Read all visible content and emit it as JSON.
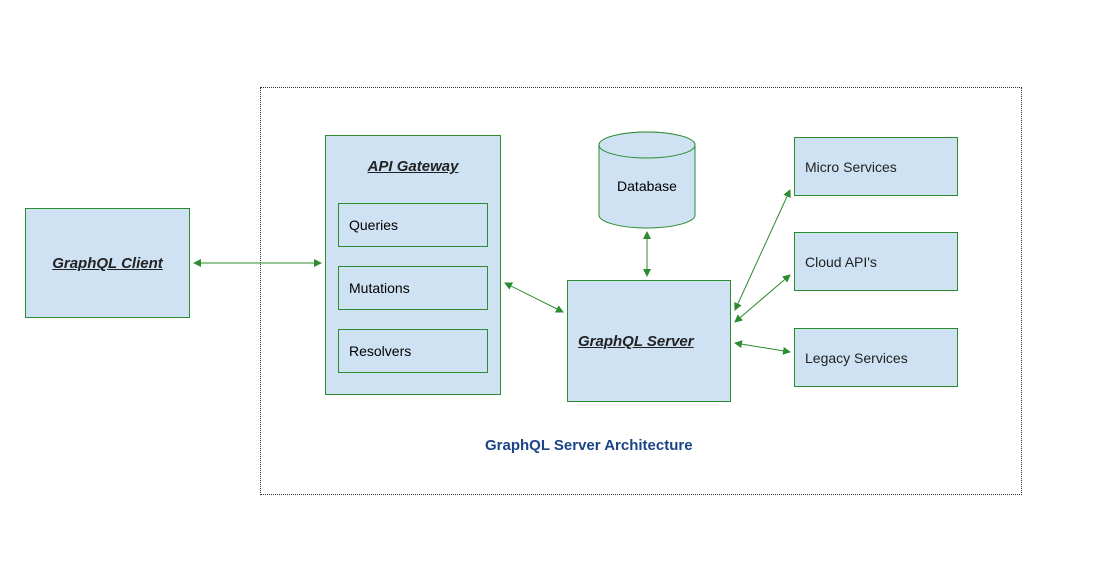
{
  "diagram": {
    "caption": "GraphQL Server Architecture",
    "client": {
      "label": "GraphQL Client"
    },
    "gateway": {
      "title": "API Gateway",
      "items": [
        "Queries",
        "Mutations",
        "Resolvers"
      ]
    },
    "server": {
      "label": "GraphQL Server"
    },
    "database": {
      "label": "Database"
    },
    "services": {
      "micro": "Micro Services",
      "cloud": "Cloud API's",
      "legacy": "Legacy Services"
    }
  }
}
